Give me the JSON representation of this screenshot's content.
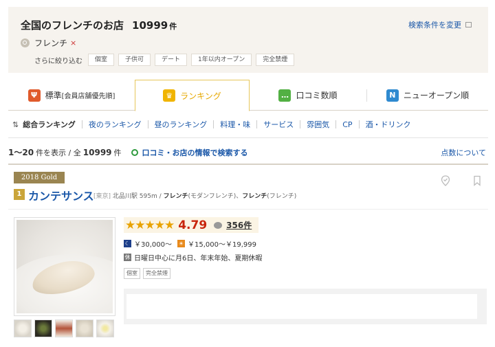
{
  "header": {
    "title": "全国のフレンチのお店",
    "count": "10999",
    "count_unit": "件",
    "change_conditions": "検索条件を変更",
    "keyword": "フレンチ",
    "keyword_remove": "×",
    "narrow_label": "さらに絞り込む",
    "filters": [
      "個室",
      "子供可",
      "デート",
      "1年以内オープン",
      "完全禁煙"
    ]
  },
  "tabs": [
    {
      "label": "標準",
      "sub": "[会員店舗優先順]",
      "icon": "fork-knife-icon",
      "icon_color": "#e05a2b",
      "active": false
    },
    {
      "label": "ランキング",
      "sub": "",
      "icon": "crown-icon",
      "icon_color": "#f0b400",
      "active": true
    },
    {
      "label": "口コミ数順",
      "sub": "",
      "icon": "speech-bubble-icon",
      "icon_color": "#52b043",
      "active": false
    },
    {
      "label": "ニューオープン順",
      "sub": "",
      "icon": "new-icon",
      "icon_color": "#2f8ad0",
      "active": false
    }
  ],
  "subnav": {
    "current": "総合ランキング",
    "items": [
      "夜のランキング",
      "昼のランキング",
      "料理・味",
      "サービス",
      "雰囲気",
      "CP",
      "酒・ドリンク"
    ]
  },
  "summary": {
    "range": "1〜20",
    "range_suffix": "件を表示 / 全",
    "total": "10999",
    "total_unit": "件",
    "review_search": "口コミ・お店の情報で検索する",
    "point_link": "点数について"
  },
  "restaurant": {
    "award": "2018 Gold",
    "rank": "1",
    "name": "カンテサンス",
    "area": "[東京]",
    "station": "北品川駅 595m /",
    "genre1": "フレンチ",
    "genre1_sub": "(モダンフレンチ)、",
    "genre2": "フレンチ",
    "genre2_sub": "(フレンチ)",
    "stars": "★★★★★",
    "rating": 4.79,
    "rating_text": "4.79",
    "reviews": "356件",
    "dinner_budget": "￥30,000〜",
    "lunch_budget": "￥15,000〜￥19,999",
    "holiday_icon_text": "休",
    "holiday": "日曜日中心に月6日、年末年始、夏期休暇",
    "tags": [
      "個室",
      "完全禁煙"
    ]
  },
  "colors": {
    "link": "#1a57a8",
    "score": "#c8250c",
    "star": "#e8a200",
    "award_bg": "#9a8551",
    "active_tab": "#e6a800"
  }
}
